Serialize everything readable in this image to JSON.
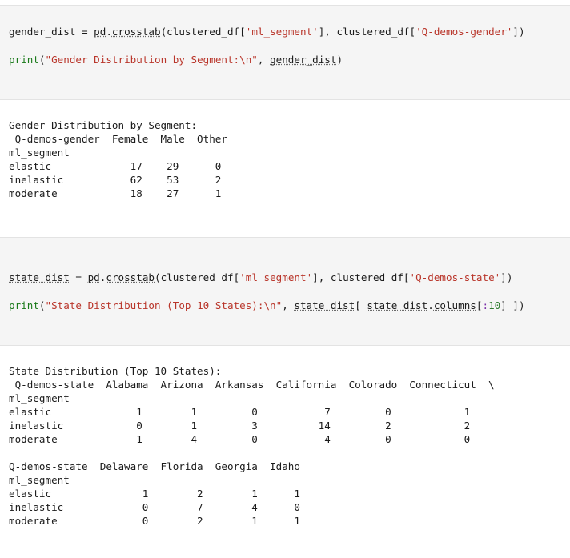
{
  "cell1": {
    "line1": {
      "var": "gender_dist",
      "eq": " = ",
      "mod": "pd",
      "dot": ".",
      "fn": "crosstab",
      "open": "(clustered_df[",
      "s1": "'ml_segment'",
      "mid": "], clustered_df[",
      "s2": "'Q-demos-gender'",
      "close": "])"
    },
    "line2": {
      "print": "print",
      "open": "(",
      "str": "\"Gender Distribution by Segment:\\n\"",
      "sep": ", ",
      "arg": "gender_dist",
      "close": ")"
    }
  },
  "output1": {
    "lines": [
      "Gender Distribution by Segment:",
      " Q-demos-gender  Female  Male  Other",
      "ml_segment",
      "elastic             17    29      0",
      "inelastic           62    53      2",
      "moderate            18    27      1"
    ]
  },
  "cell2": {
    "line1": {
      "var": "state_dist",
      "eq": " = ",
      "mod": "pd",
      "dot": ".",
      "fn": "crosstab",
      "open": "(clustered_df[",
      "s1": "'ml_segment'",
      "mid": "], clustered_df[",
      "s2": "'Q-demos-state'",
      "close": "])"
    },
    "line2": {
      "print": "print",
      "open": "(",
      "str": "\"State Distribution (Top 10 States):\\n\"",
      "sep": ", ",
      "arg": "state_dist",
      "br": "[ ",
      "arg2": "state_dist",
      "dot": ".",
      "attr": "columns",
      "slice_open": "[",
      "colon": ":",
      "num": "10",
      "slice_close": "]",
      "close": " ])"
    }
  },
  "output2": {
    "block1": [
      "State Distribution (Top 10 States):",
      " Q-demos-state  Alabama  Arizona  Arkansas  California  Colorado  Connecticut  \\",
      "ml_segment",
      "elastic              1        1         0           7         0            1",
      "inelastic            0        1         3          14         2            2",
      "moderate             1        4         0           4         0            0"
    ],
    "block2": [
      "Q-demos-state  Delaware  Florida  Georgia  Idaho",
      "ml_segment",
      "elastic               1        2        1      1",
      "inelastic             0        7        4      0",
      "moderate              0        2        1      1"
    ]
  }
}
